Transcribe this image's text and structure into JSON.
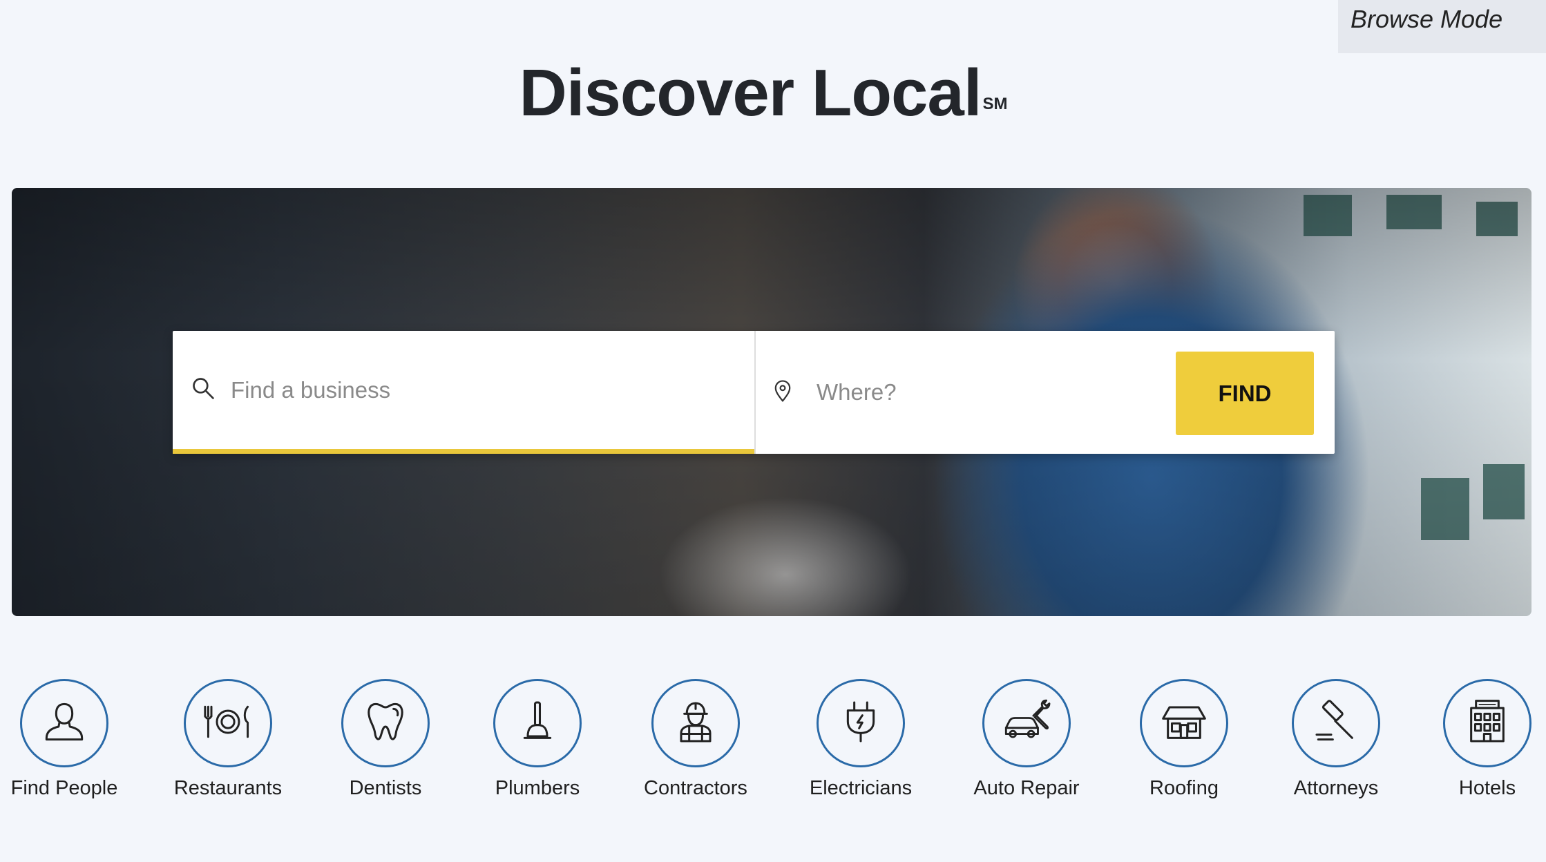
{
  "browse_mode": {
    "label": "Browse Mode"
  },
  "hero_title": {
    "text": "Discover Local",
    "mark": "SM"
  },
  "search": {
    "what_placeholder": "Find a business",
    "where_placeholder": "Where?",
    "find_label": "FIND"
  },
  "categories": [
    {
      "label": "Find People",
      "icon": "person-icon"
    },
    {
      "label": "Restaurants",
      "icon": "plate-utensils-icon"
    },
    {
      "label": "Dentists",
      "icon": "tooth-icon"
    },
    {
      "label": "Plumbers",
      "icon": "plunger-icon"
    },
    {
      "label": "Contractors",
      "icon": "construction-worker-icon"
    },
    {
      "label": "Electricians",
      "icon": "electric-plug-icon"
    },
    {
      "label": "Auto Repair",
      "icon": "car-wrench-icon"
    },
    {
      "label": "Roofing",
      "icon": "house-roof-icon"
    },
    {
      "label": "Attorneys",
      "icon": "gavel-icon"
    },
    {
      "label": "Hotels",
      "icon": "hotel-building-icon"
    }
  ],
  "colors": {
    "accent_yellow": "#efcd3c",
    "circle_blue": "#2a6aa8",
    "page_bg": "#f3f6fb"
  }
}
